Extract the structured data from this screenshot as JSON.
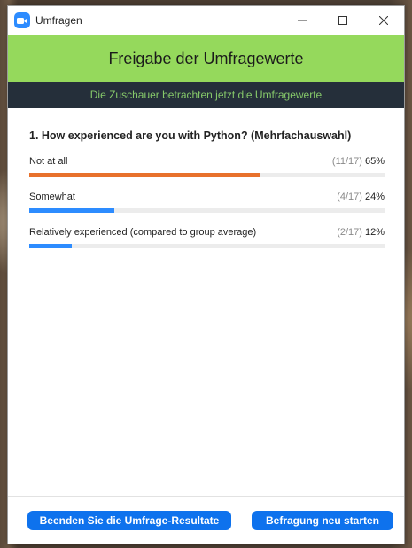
{
  "window": {
    "title": "Umfragen",
    "controls": [
      "minimize",
      "maximize",
      "close"
    ]
  },
  "header": {
    "title": "Freigabe der Umfragewerte"
  },
  "banner": {
    "text": "Die Zuschauer betrachten jetzt die Umfragewerte"
  },
  "poll": {
    "question": "1. How experienced are you with Python? (Mehrfachauswahl)",
    "answers": [
      {
        "label": "Not at all",
        "count": "(11/17)",
        "percent": "65%",
        "fraction": 0.65,
        "color": "#e8712c"
      },
      {
        "label": "Somewhat",
        "count": "(4/17)",
        "percent": "24%",
        "fraction": 0.24,
        "color": "#2d8cff"
      },
      {
        "label": "Relatively experienced (compared to group average)",
        "count": "(2/17)",
        "percent": "12%",
        "fraction": 0.12,
        "color": "#2d8cff"
      }
    ]
  },
  "footer": {
    "end_label": "Beenden Sie die Umfrage-Resultate",
    "restart_label": "Befragung neu starten"
  },
  "colors": {
    "header_green": "#95d95c",
    "banner_dark": "#252f3a",
    "banner_text": "#86c96a",
    "button_blue": "#0e72ed"
  }
}
